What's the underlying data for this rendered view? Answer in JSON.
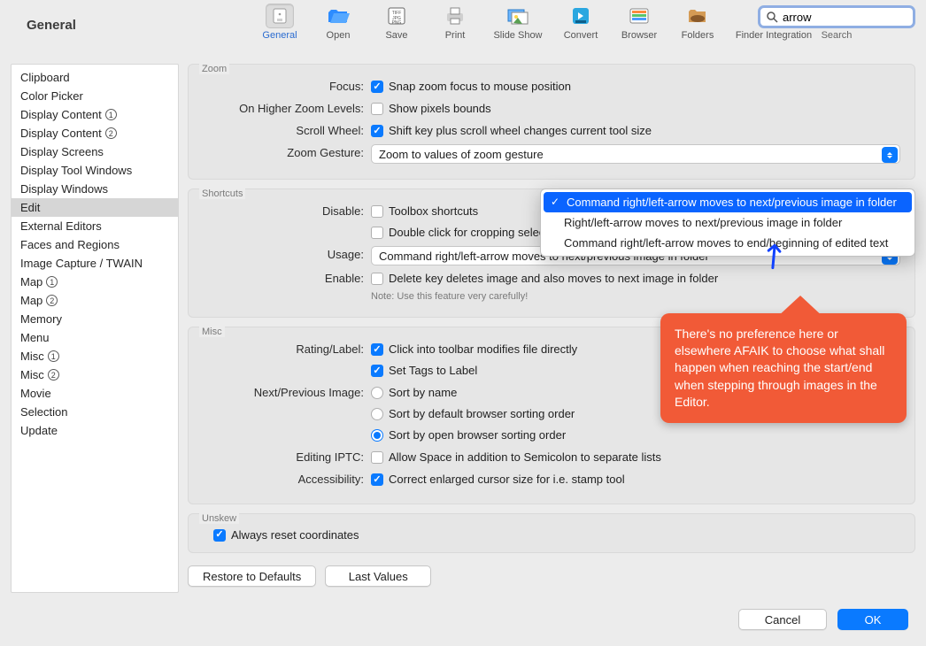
{
  "title": "General",
  "toolbar": {
    "items": [
      {
        "label": "General",
        "selected": true
      },
      {
        "label": "Open",
        "selected": false
      },
      {
        "label": "Save",
        "selected": false
      },
      {
        "label": "Print",
        "selected": false
      },
      {
        "label": "Slide Show",
        "selected": false
      },
      {
        "label": "Convert",
        "selected": false
      },
      {
        "label": "Browser",
        "selected": false
      },
      {
        "label": "Folders",
        "selected": false
      },
      {
        "label": "Finder Integration",
        "selected": false
      }
    ]
  },
  "search": {
    "value": "arrow",
    "label": "Search"
  },
  "sidebar": {
    "items": [
      {
        "label": "Clipboard"
      },
      {
        "label": "Color Picker"
      },
      {
        "label": "Display Content",
        "badge": "1"
      },
      {
        "label": "Display Content",
        "badge": "2"
      },
      {
        "label": "Display Screens"
      },
      {
        "label": "Display Tool Windows"
      },
      {
        "label": "Display Windows"
      },
      {
        "label": "Edit",
        "selected": true
      },
      {
        "label": "External Editors"
      },
      {
        "label": "Faces and Regions"
      },
      {
        "label": "Image Capture / TWAIN"
      },
      {
        "label": "Map",
        "badge": "1"
      },
      {
        "label": "Map",
        "badge": "2"
      },
      {
        "label": "Memory"
      },
      {
        "label": "Menu"
      },
      {
        "label": "Misc",
        "badge": "1"
      },
      {
        "label": "Misc",
        "badge": "2"
      },
      {
        "label": "Movie"
      },
      {
        "label": "Selection"
      },
      {
        "label": "Update"
      }
    ]
  },
  "zoom": {
    "title": "Zoom",
    "focus_label": "Focus:",
    "focus_cb": "Snap zoom focus to mouse position",
    "higher_label": "On Higher Zoom Levels:",
    "higher_cb": "Show pixels bounds",
    "scroll_label": "Scroll Wheel:",
    "scroll_cb": "Shift key plus scroll wheel changes current tool size",
    "gesture_label": "Zoom Gesture:",
    "gesture_sel": "Zoom to values of zoom gesture"
  },
  "shortcuts": {
    "title": "Shortcuts",
    "disable_label": "Disable:",
    "disable_cb1": "Toolbox shortcuts",
    "disable_cb2": "Double click for cropping selection",
    "usage_label": "Usage:",
    "usage_sel": "Command right/left-arrow moves to next/previous image in folder",
    "enable_label": "Enable:",
    "enable_cb": "Delete key deletes image and also moves to next image in folder",
    "enable_note": "Note: Use this feature very carefully!"
  },
  "dropdown": {
    "items": [
      {
        "label": "Command right/left-arrow moves to next/previous image in folder",
        "selected": true
      },
      {
        "label": "Right/left-arrow moves to next/previous image in folder"
      },
      {
        "label": "Command right/left-arrow moves to end/beginning of edited text"
      }
    ]
  },
  "misc": {
    "title": "Misc",
    "rating_label": "Rating/Label:",
    "rating_cb1": "Click into toolbar modifies file directly",
    "rating_cb2": "Set Tags to Label",
    "next_label": "Next/Previous Image:",
    "next_r1": "Sort by name",
    "next_r2": "Sort by default browser sorting order",
    "next_r3": "Sort by open browser sorting order",
    "iptc_label": "Editing IPTC:",
    "iptc_cb": "Allow Space in addition to Semicolon to separate lists",
    "acc_label": "Accessibility:",
    "acc_cb": "Correct enlarged cursor size for i.e. stamp tool"
  },
  "unskew": {
    "title": "Unskew",
    "cb": "Always reset coordinates"
  },
  "callout": "There's no preference here or elsewhere AFAIK to choose what shall happen when reaching the start/end when stepping through images in the Editor.",
  "buttons": {
    "restore": "Restore to Defaults",
    "last": "Last Values",
    "cancel": "Cancel",
    "ok": "OK"
  }
}
